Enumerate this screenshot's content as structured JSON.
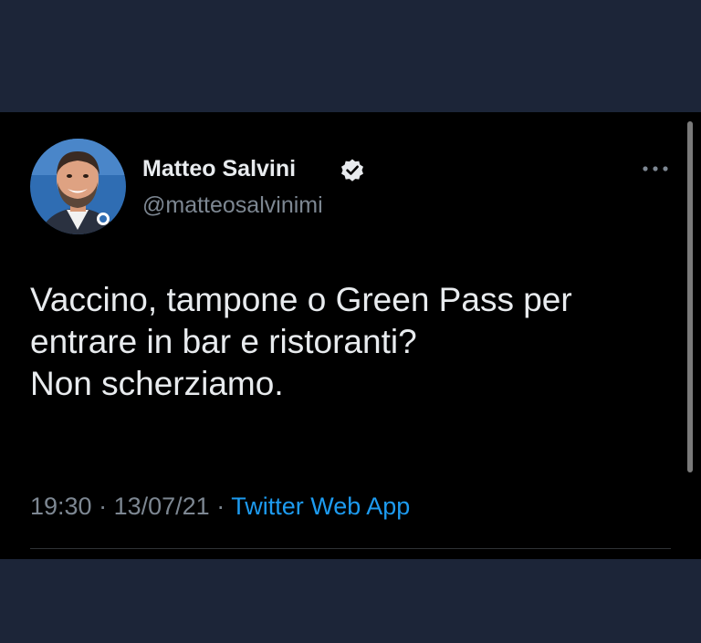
{
  "tweet": {
    "author": {
      "name": "Matteo Salvini",
      "handle": "@matteosalvinimi",
      "verified": true,
      "avatar": "profile-photo"
    },
    "text_lines": [
      "Vaccino, tampone o Green Pass per",
      "entrare in bar e ristoranti?",
      "Non scherziamo."
    ],
    "time": "19:30",
    "date": "13/07/21",
    "separator": " · ",
    "source": "Twitter Web App",
    "more_icon": "ellipsis-icon"
  },
  "colors": {
    "page_background": "#1c2538",
    "card_background": "#000000",
    "primary_text": "#e8ebee",
    "secondary_text": "#7d8792",
    "link": "#1d9bf0"
  }
}
